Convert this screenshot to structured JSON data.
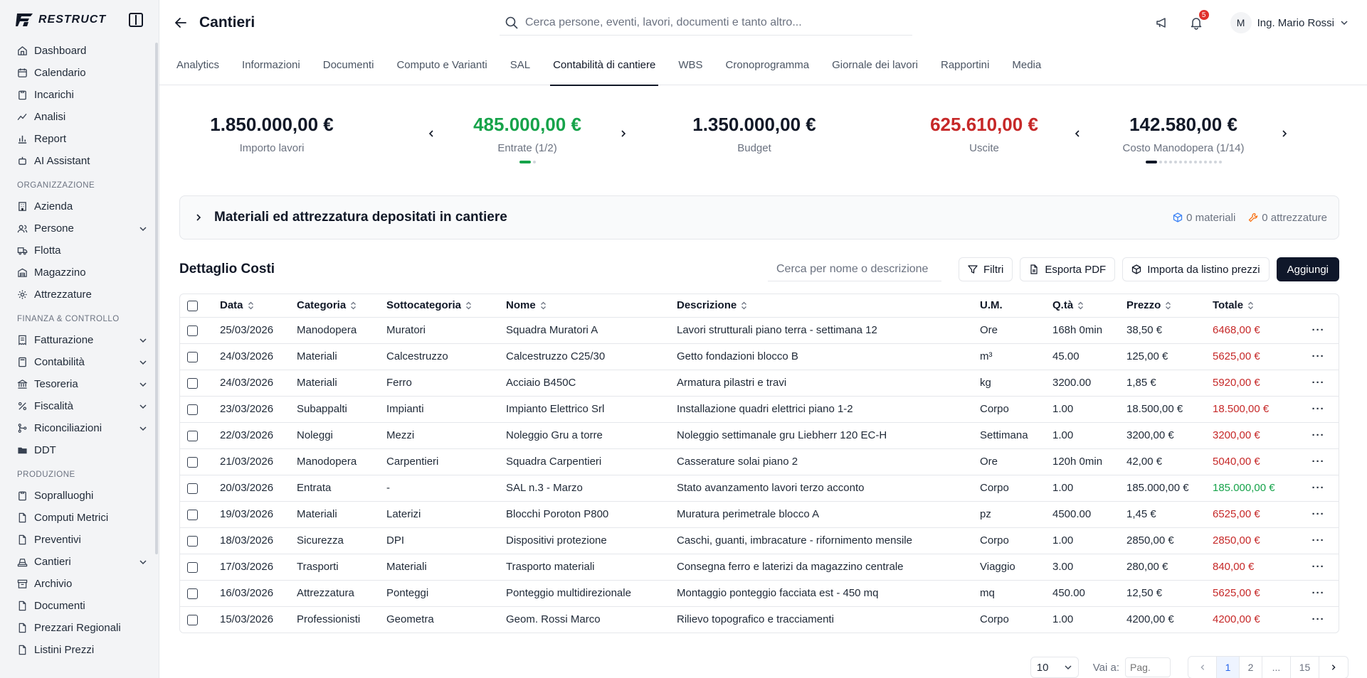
{
  "brand": {
    "name": "RESTRUCT"
  },
  "sidebar": {
    "items_top": [
      {
        "label": "Dashboard",
        "icon": "home-icon"
      },
      {
        "label": "Calendario",
        "icon": "calendar-icon"
      },
      {
        "label": "Incarichi",
        "icon": "clipboard-icon"
      },
      {
        "label": "Analisi",
        "icon": "chart-line-icon"
      },
      {
        "label": "Report",
        "icon": "bar-chart-icon"
      },
      {
        "label": "AI Assistant",
        "icon": "bot-icon"
      }
    ],
    "section_org": "ORGANIZZAZIONE",
    "items_org": [
      {
        "label": "Azienda",
        "icon": "building-icon"
      },
      {
        "label": "Persone",
        "icon": "users-icon"
      },
      {
        "label": "Flotta",
        "icon": "truck-icon"
      },
      {
        "label": "Magazzino",
        "icon": "warehouse-icon"
      },
      {
        "label": "Attrezzature",
        "icon": "gear-icon"
      }
    ],
    "section_fin": "FINANZA & CONTROLLO",
    "items_fin": [
      {
        "label": "Fatturazione",
        "icon": "invoice-icon"
      },
      {
        "label": "Contabilità",
        "icon": "calculator-icon"
      },
      {
        "label": "Tesoreria",
        "icon": "bank-icon"
      },
      {
        "label": "Fiscalità",
        "icon": "percent-icon"
      },
      {
        "label": "Riconciliazioni",
        "icon": "merge-icon"
      },
      {
        "label": "DDT",
        "icon": "folder-icon"
      }
    ],
    "section_prod": "PRODUZIONE",
    "items_prod": [
      {
        "label": "Sopralluoghi",
        "icon": "clipboard-icon"
      },
      {
        "label": "Computi Metrici",
        "icon": "document-icon"
      },
      {
        "label": "Preventivi",
        "icon": "document-icon"
      },
      {
        "label": "Cantieri",
        "icon": "construction-icon"
      },
      {
        "label": "Archivio",
        "icon": "archive-icon"
      },
      {
        "label": "Documenti",
        "icon": "document-icon"
      },
      {
        "label": "Prezzari Regionali",
        "icon": "document-icon"
      },
      {
        "label": "Listini Prezzi",
        "icon": "document-icon"
      }
    ]
  },
  "header": {
    "title": "Cantieri",
    "search_placeholder": "Cerca persone, eventi, lavori, documenti e tanto altro...",
    "notifications": "5",
    "user_initial": "M",
    "user_name": "Ing. Mario Rossi"
  },
  "tabs": [
    "Analytics",
    "Informazioni",
    "Documenti",
    "Computo e Varianti",
    "SAL",
    "Contabilità di cantiere",
    "WBS",
    "Cronoprogramma",
    "Giornale dei lavori",
    "Rapportini",
    "Media"
  ],
  "kpis": {
    "importo": {
      "value": "1.850.000,00 €",
      "label": "Importo lavori"
    },
    "entrate": {
      "value": "485.000,00 €",
      "label": "Entrate (1/2)"
    },
    "budget": {
      "value": "1.350.000,00 €",
      "label": "Budget"
    },
    "uscite": {
      "value": "625.610,00 €",
      "label": "Uscite"
    },
    "manodopera": {
      "value": "142.580,00 €",
      "label": "Costo Manodopera (1/14)"
    }
  },
  "materials_panel": {
    "title": "Materiali ed attrezzatura depositati in cantiere",
    "materials": "0 materiali",
    "equipment": "0 attrezzature"
  },
  "costs": {
    "title": "Dettaglio Costi",
    "search_placeholder": "Cerca per nome o descrizione",
    "filters": "Filtri",
    "export": "Esporta PDF",
    "import": "Importa da listino prezzi",
    "add": "Aggiungi",
    "columns": [
      "Data",
      "Categoria",
      "Sottocategoria",
      "Nome",
      "Descrizione",
      "U.M.",
      "Q.tà",
      "Prezzo",
      "Totale"
    ],
    "rows": [
      [
        "25/03/2026",
        "Manodopera",
        "Muratori",
        "Squadra Muratori A",
        "Lavori strutturali piano terra - settimana 12",
        "Ore",
        "168h 0min",
        "38,50 €",
        "6468,00 €"
      ],
      [
        "24/03/2026",
        "Materiali",
        "Calcestruzzo",
        "Calcestruzzo C25/30",
        "Getto fondazioni blocco B",
        "m³",
        "45.00",
        "125,00 €",
        "5625,00 €"
      ],
      [
        "24/03/2026",
        "Materiali",
        "Ferro",
        "Acciaio B450C",
        "Armatura pilastri e travi",
        "kg",
        "3200.00",
        "1,85 €",
        "5920,00 €"
      ],
      [
        "23/03/2026",
        "Subappalti",
        "Impianti",
        "Impianto Elettrico Srl",
        "Installazione quadri elettrici piano 1-2",
        "Corpo",
        "1.00",
        "18.500,00 €",
        "18.500,00 €"
      ],
      [
        "22/03/2026",
        "Noleggi",
        "Mezzi",
        "Noleggio Gru a torre",
        "Noleggio settimanale gru Liebherr 120 EC-H",
        "Settimana",
        "1.00",
        "3200,00 €",
        "3200,00 €"
      ],
      [
        "21/03/2026",
        "Manodopera",
        "Carpentieri",
        "Squadra Carpentieri",
        "Casserature solai piano 2",
        "Ore",
        "120h 0min",
        "42,00 €",
        "5040,00 €"
      ],
      [
        "20/03/2026",
        "Entrata",
        "-",
        "SAL n.3 - Marzo",
        "Stato avanzamento lavori terzo acconto",
        "Corpo",
        "1.00",
        "185.000,00 €",
        "185.000,00 €"
      ],
      [
        "19/03/2026",
        "Materiali",
        "Laterizi",
        "Blocchi Poroton P800",
        "Muratura perimetrale blocco A",
        "pz",
        "4500.00",
        "1,45 €",
        "6525,00 €"
      ],
      [
        "18/03/2026",
        "Sicurezza",
        "DPI",
        "Dispositivi protezione",
        "Caschi, guanti, imbracature - rifornimento mensile",
        "Corpo",
        "1.00",
        "2850,00 €",
        "2850,00 €"
      ],
      [
        "17/03/2026",
        "Trasporti",
        "Materiali",
        "Trasporto materiali",
        "Consegna ferro e laterizi da magazzino centrale",
        "Viaggio",
        "3.00",
        "280,00 €",
        "840,00 €"
      ],
      [
        "16/03/2026",
        "Attrezzatura",
        "Ponteggi",
        "Ponteggio multidirezionale",
        "Montaggio ponteggio facciata est - 450 mq",
        "mq",
        "450.00",
        "12,50 €",
        "5625,00 €"
      ],
      [
        "15/03/2026",
        "Professionisti",
        "Geometra",
        "Geom. Rossi Marco",
        "Rilievo topografico e tracciamenti",
        "Corpo",
        "1.00",
        "4200,00 €",
        "4200,00 €"
      ]
    ],
    "income_row": 6
  },
  "pagination": {
    "page_size": "10",
    "goto_label": "Vai a:",
    "goto_placeholder": "Pag.",
    "pages": [
      "1",
      "2",
      "...",
      "15"
    ],
    "current": "1"
  },
  "colors": {
    "accent_green": "#16a34a",
    "accent_red": "#c62828",
    "primary": "#0f172a"
  }
}
